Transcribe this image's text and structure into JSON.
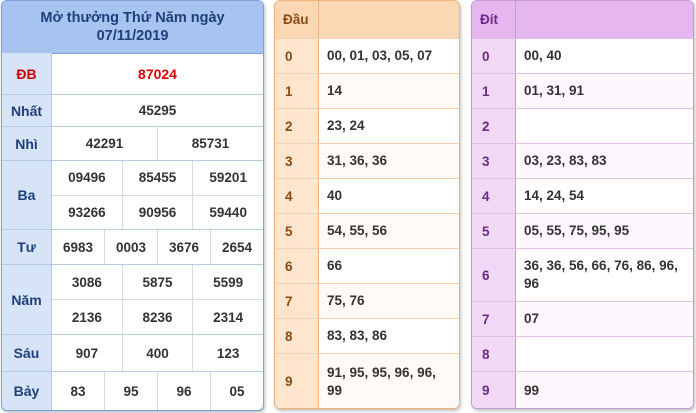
{
  "results": {
    "title_line1": "Mở thưởng Thứ Năm ngày",
    "title_line2": "07/11/2019",
    "rows": [
      {
        "label": "ĐB",
        "lines": [
          [
            "87024"
          ]
        ]
      },
      {
        "label": "Nhất",
        "lines": [
          [
            "45295"
          ]
        ]
      },
      {
        "label": "Nhì",
        "lines": [
          [
            "42291",
            "85731"
          ]
        ]
      },
      {
        "label": "Ba",
        "lines": [
          [
            "09496",
            "85455",
            "59201"
          ],
          [
            "93266",
            "90956",
            "59440"
          ]
        ]
      },
      {
        "label": "Tư",
        "lines": [
          [
            "6983",
            "0003",
            "3676",
            "2654"
          ]
        ]
      },
      {
        "label": "Năm",
        "lines": [
          [
            "3086",
            "5875",
            "5599"
          ],
          [
            "2136",
            "8236",
            "2314"
          ]
        ]
      },
      {
        "label": "Sáu",
        "lines": [
          [
            "907",
            "400",
            "123"
          ]
        ]
      },
      {
        "label": "Bảy",
        "lines": [
          [
            "83",
            "95",
            "96",
            "05"
          ]
        ]
      }
    ]
  },
  "dau": {
    "header": "Đầu",
    "rows": [
      {
        "key": "0",
        "value": "00, 01, 03, 05, 07"
      },
      {
        "key": "1",
        "value": "14"
      },
      {
        "key": "2",
        "value": "23, 24"
      },
      {
        "key": "3",
        "value": "31, 36, 36"
      },
      {
        "key": "4",
        "value": "40"
      },
      {
        "key": "5",
        "value": "54, 55, 56"
      },
      {
        "key": "6",
        "value": "66"
      },
      {
        "key": "7",
        "value": "75, 76"
      },
      {
        "key": "8",
        "value": "83, 83, 86"
      },
      {
        "key": "9",
        "value": "91, 95, 95, 96, 96, 99"
      }
    ]
  },
  "dit": {
    "header": "Đít",
    "rows": [
      {
        "key": "0",
        "value": "00, 40"
      },
      {
        "key": "1",
        "value": "01, 31, 91"
      },
      {
        "key": "2",
        "value": ""
      },
      {
        "key": "3",
        "value": "03, 23, 83, 83"
      },
      {
        "key": "4",
        "value": "14, 24, 54"
      },
      {
        "key": "5",
        "value": "05, 55, 75, 95, 95"
      },
      {
        "key": "6",
        "value": "36, 36, 56, 66, 76, 86, 96, 96"
      },
      {
        "key": "7",
        "value": "07"
      },
      {
        "key": "8",
        "value": ""
      },
      {
        "key": "9",
        "value": "99"
      }
    ]
  },
  "colors": {
    "results_header": "#a7c4f0",
    "results_label": "#d7e4f7",
    "special_prize": "#dd0000",
    "dau_header": "#fcd7b3",
    "dit_header": "#e6b6ef"
  }
}
